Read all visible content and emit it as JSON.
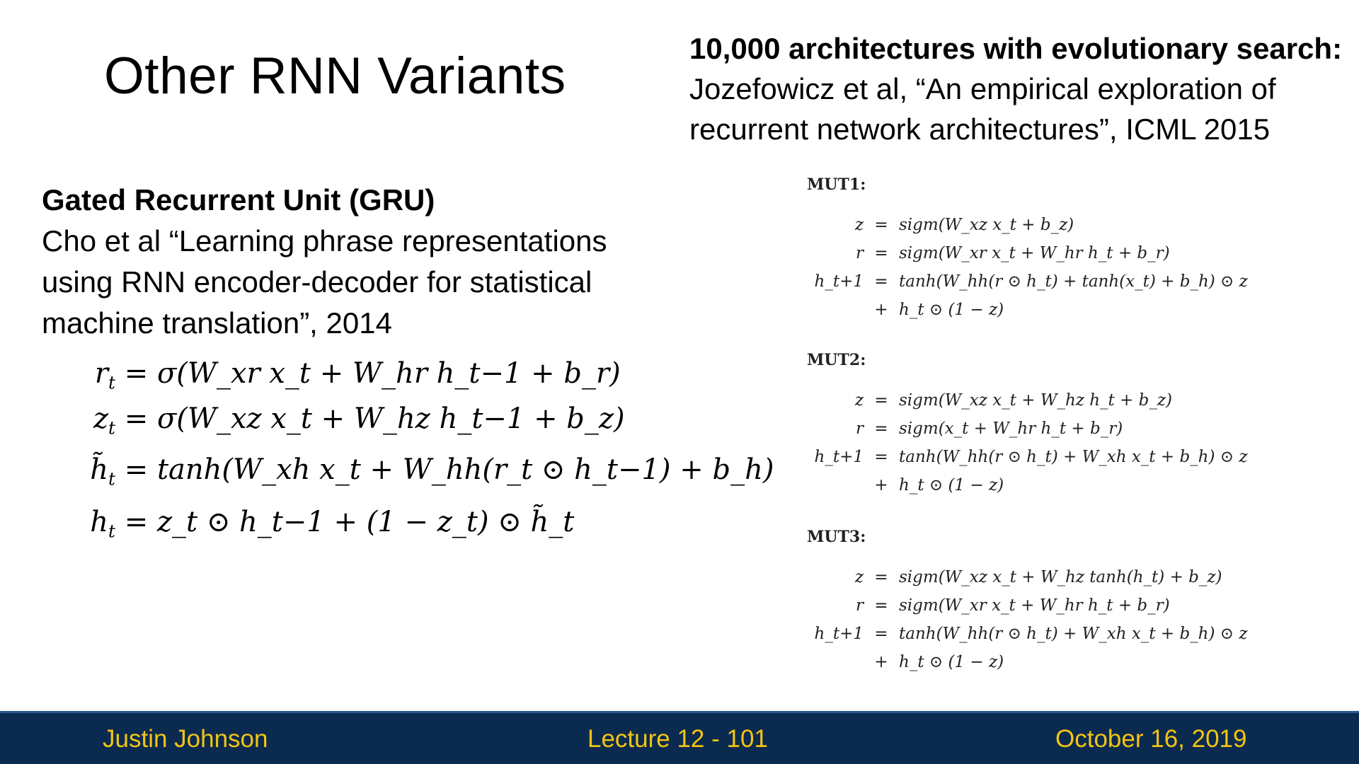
{
  "slide": {
    "title": "Other RNN Variants",
    "right_reference": {
      "heading": "10,000 architectures with evolutionary search:",
      "lines": [
        "Jozefowicz et al, “An empirical exploration of",
        "recurrent network architectures”, ICML 2015"
      ]
    },
    "gru_reference": {
      "heading": "Gated Recurrent Unit (GRU)",
      "lines": [
        "Cho et al “Learning phrase representations",
        "using RNN encoder-decoder for statistical",
        "machine translation”, 2014"
      ]
    },
    "gru_equations": [
      {
        "lhs": "r",
        "lhs_sub": "t",
        "rhs": "= σ(W_xr x_t + W_hr h_t−1 + b_r)"
      },
      {
        "lhs": "z",
        "lhs_sub": "t",
        "rhs": "= σ(W_xz x_t + W_hz h_t−1 + b_z)"
      },
      {
        "lhs": "h̃",
        "lhs_sub": "t",
        "rhs": "= tanh(W_xh x_t + W_hh(r_t ⊙ h_t−1) + b_h)"
      },
      {
        "lhs": "h",
        "lhs_sub": "t",
        "rhs": "= z_t ⊙ h_t−1 + (1 − z_t) ⊙ h̃_t"
      }
    ],
    "mutations": [
      {
        "label": "MUT1:",
        "rows": [
          {
            "lhs": "z",
            "op": "=",
            "rhs": "sigm(W_xz x_t + b_z)"
          },
          {
            "lhs": "r",
            "op": "=",
            "rhs": "sigm(W_xr x_t + W_hr h_t + b_r)"
          },
          {
            "lhs": "h_t+1",
            "op": "=",
            "rhs": "tanh(W_hh(r ⊙ h_t) + tanh(x_t) + b_h) ⊙ z"
          },
          {
            "lhs": "",
            "op": "+",
            "rhs": "h_t ⊙ (1 − z)"
          }
        ]
      },
      {
        "label": "MUT2:",
        "rows": [
          {
            "lhs": "z",
            "op": "=",
            "rhs": "sigm(W_xz x_t + W_hz h_t + b_z)"
          },
          {
            "lhs": "r",
            "op": "=",
            "rhs": "sigm(x_t + W_hr h_t + b_r)"
          },
          {
            "lhs": "h_t+1",
            "op": "=",
            "rhs": "tanh(W_hh(r ⊙ h_t) + W_xh x_t + b_h) ⊙ z"
          },
          {
            "lhs": "",
            "op": "+",
            "rhs": "h_t ⊙ (1 − z)"
          }
        ]
      },
      {
        "label": "MUT3:",
        "rows": [
          {
            "lhs": "z",
            "op": "=",
            "rhs": "sigm(W_xz x_t + W_hz tanh(h_t) + b_z)"
          },
          {
            "lhs": "r",
            "op": "=",
            "rhs": "sigm(W_xr x_t + W_hr h_t + b_r)"
          },
          {
            "lhs": "h_t+1",
            "op": "=",
            "rhs": "tanh(W_hh(r ⊙ h_t) + W_xh x_t + b_h) ⊙ z"
          },
          {
            "lhs": "",
            "op": "+",
            "rhs": "h_t ⊙ (1 − z)"
          }
        ]
      }
    ]
  },
  "footer": {
    "author": "Justin Johnson",
    "lecture": "Lecture 12 - 101",
    "date": "October 16, 2019",
    "background_color": "#0b2a4f",
    "text_color": "#f2c413"
  }
}
